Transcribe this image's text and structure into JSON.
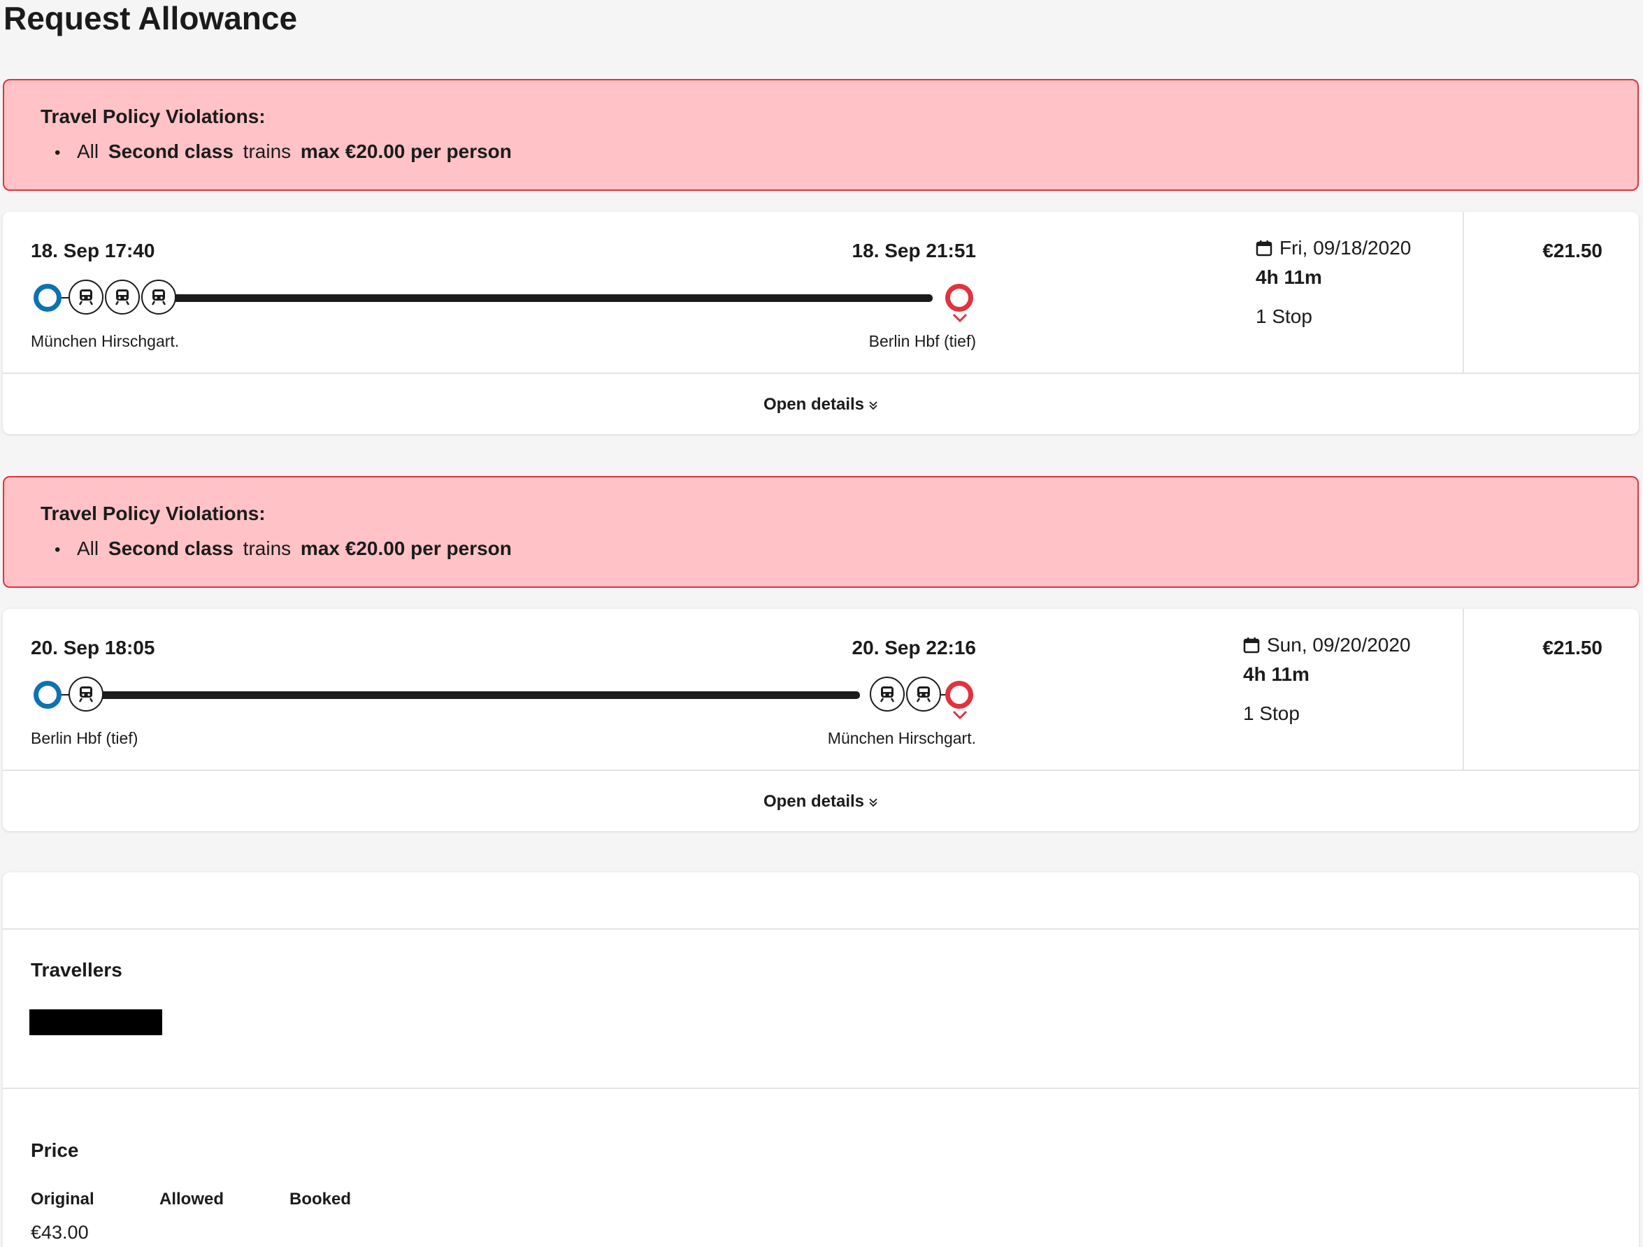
{
  "page": {
    "title": "Request Allowance"
  },
  "violations": [
    {
      "title": "Travel Policy Violations:",
      "rule": {
        "prefix": "All",
        "class_label": "Second class",
        "mid": "trains",
        "limit": "max €20.00 per person"
      }
    },
    {
      "title": "Travel Policy Violations:",
      "rule": {
        "prefix": "All",
        "class_label": "Second class",
        "mid": "trains",
        "limit": "max €20.00 per person"
      }
    }
  ],
  "trips": [
    {
      "departure_time": "18. Sep 17:40",
      "arrival_time": "18. Sep 21:51",
      "departure_station": "München Hirschgart.",
      "arrival_station": "Berlin Hbf (tief)",
      "date": "Fri, 09/18/2020",
      "duration": "4h 11m",
      "stops": "1 Stop",
      "price": "€21.50",
      "open_details_label": "Open details"
    },
    {
      "departure_time": "20. Sep 18:05",
      "arrival_time": "20. Sep 22:16",
      "departure_station": "Berlin Hbf (tief)",
      "arrival_station": "München Hirschgart.",
      "date": "Sun, 09/20/2020",
      "duration": "4h 11m",
      "stops": "1 Stop",
      "price": "€21.50",
      "open_details_label": "Open details"
    }
  ],
  "summary": {
    "travellers_title": "Travellers",
    "price_title": "Price",
    "columns": {
      "original": "Original",
      "allowed": "Allowed",
      "booked": "Booked"
    },
    "original_value": "€43.00"
  },
  "colors": {
    "departure": "#0c72b1",
    "arrival": "#e2323e",
    "violation_bg": "#ffc2c7"
  },
  "icons": [
    "train-icon",
    "calendar-icon",
    "chevron-down-icon",
    "double-chevron-down-icon"
  ]
}
